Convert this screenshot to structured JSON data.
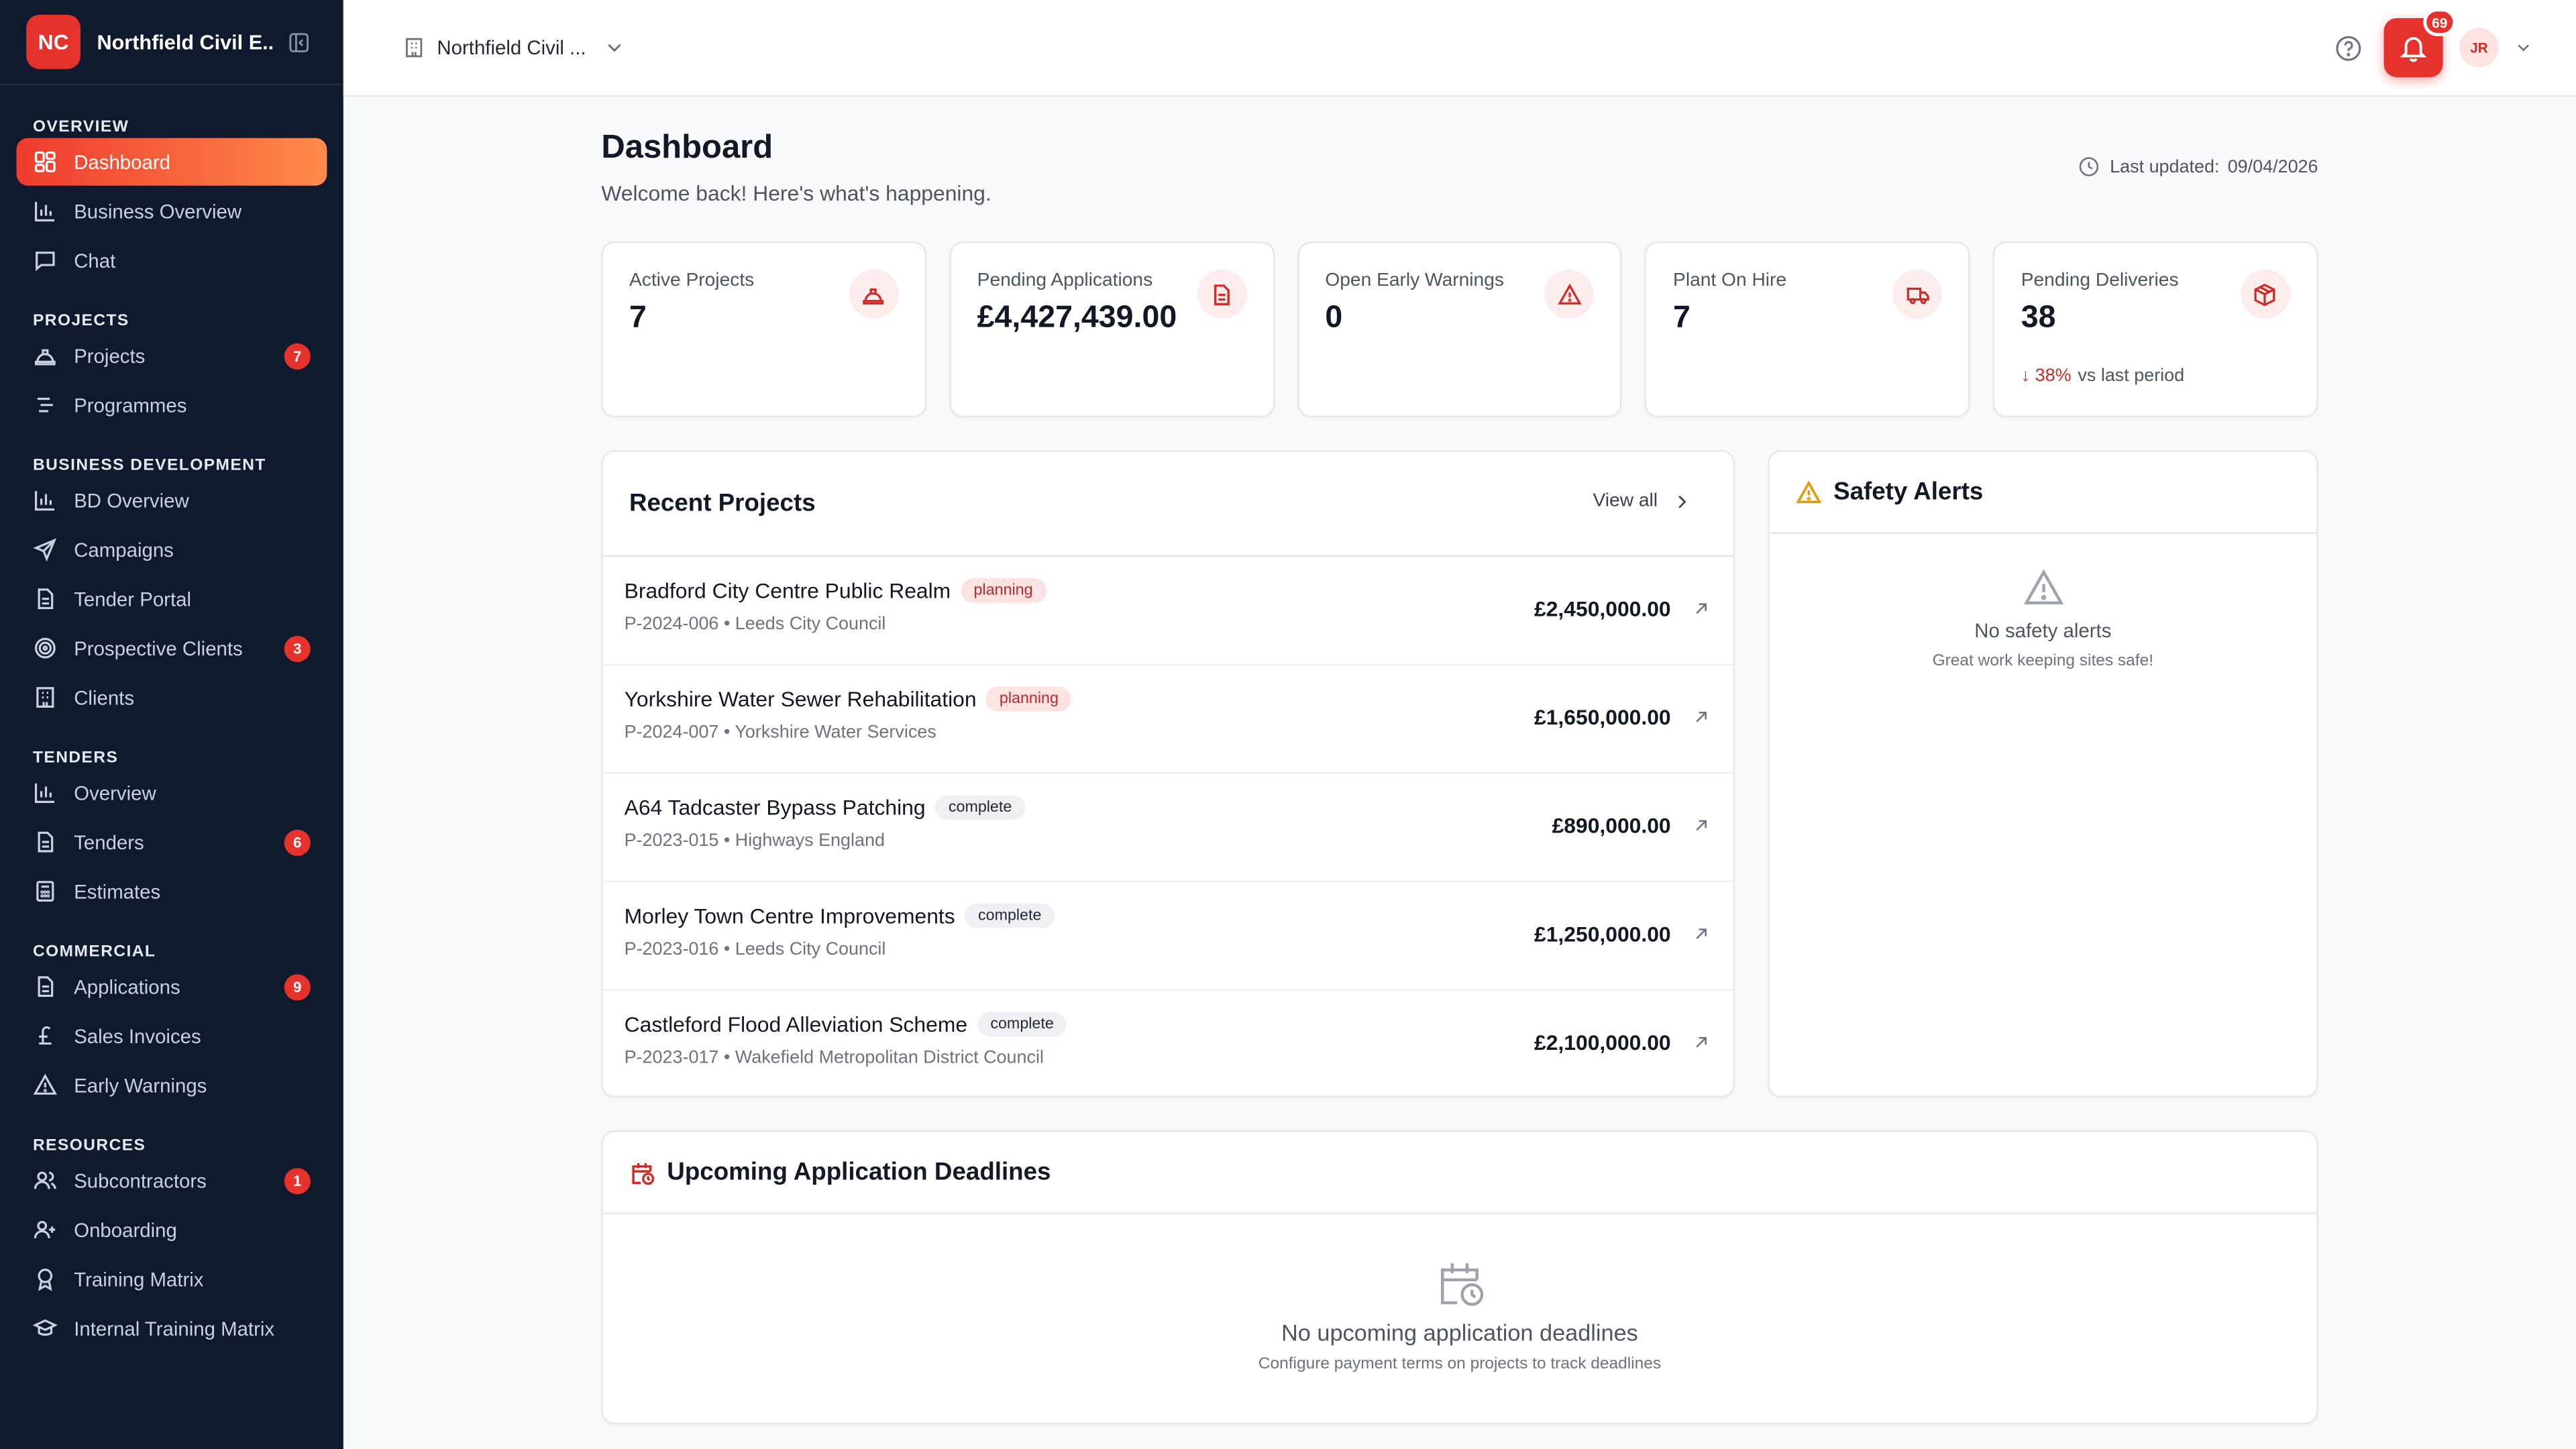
{
  "brand": {
    "initials": "NC",
    "name": "Northfield Civil E..."
  },
  "nav": {
    "sections": {
      "overview": "OVERVIEW",
      "projects": "PROJECTS",
      "business_development": "BUSINESS DEVELOPMENT",
      "tenders": "TENDERS",
      "commercial": "COMMERCIAL",
      "resources": "RESOURCES"
    },
    "items": {
      "dashboard": "Dashboard",
      "business_overview": "Business Overview",
      "chat": "Chat",
      "projects": "Projects",
      "programmes": "Programmes",
      "bd_overview": "BD Overview",
      "campaigns": "Campaigns",
      "tender_portal": "Tender Portal",
      "prospective_clients": "Prospective Clients",
      "clients": "Clients",
      "tenders_overview": "Overview",
      "tenders": "Tenders",
      "estimates": "Estimates",
      "applications": "Applications",
      "sales_invoices": "Sales Invoices",
      "early_warnings": "Early Warnings",
      "subcontractors": "Subcontractors",
      "onboarding": "Onboarding",
      "training_matrix": "Training Matrix",
      "internal_training_matrix": "Internal Training Matrix"
    },
    "badges": {
      "projects": "7",
      "prospective_clients": "3",
      "tenders": "6",
      "applications": "9",
      "subcontractors": "1"
    }
  },
  "topbar": {
    "org_name": "Northfield Civil ...",
    "notification_count": "69",
    "avatar_initials": "JR"
  },
  "page": {
    "title": "Dashboard",
    "subtitle": "Welcome back! Here's what's happening.",
    "last_updated_label": "Last updated:",
    "last_updated_value": "09/04/2026"
  },
  "stats": [
    {
      "label": "Active Projects",
      "value": "7"
    },
    {
      "label": "Pending Applications",
      "value": "£4,427,439.00"
    },
    {
      "label": "Open Early Warnings",
      "value": "0"
    },
    {
      "label": "Plant On Hire",
      "value": "7"
    },
    {
      "label": "Pending Deliveries",
      "value": "38",
      "trend": "↓ 38%",
      "trend_text": "vs last period"
    }
  ],
  "recent_projects": {
    "title": "Recent Projects",
    "view_all": "View all",
    "rows": [
      {
        "name": "Bradford City Centre Public Realm",
        "status": "planning",
        "meta": "P-2024-006 • Leeds City Council",
        "value": "£2,450,000.00"
      },
      {
        "name": "Yorkshire Water Sewer Rehabilitation",
        "status": "planning",
        "meta": "P-2024-007 • Yorkshire Water Services",
        "value": "£1,650,000.00"
      },
      {
        "name": "A64 Tadcaster Bypass Patching",
        "status": "complete",
        "meta": "P-2023-015 • Highways England",
        "value": "£890,000.00"
      },
      {
        "name": "Morley Town Centre Improvements",
        "status": "complete",
        "meta": "P-2023-016 • Leeds City Council",
        "value": "£1,250,000.00"
      },
      {
        "name": "Castleford Flood Alleviation Scheme",
        "status": "complete",
        "meta": "P-2023-017 • Wakefield Metropolitan District Council",
        "value": "£2,100,000.00"
      }
    ]
  },
  "safety_alerts": {
    "title": "Safety Alerts",
    "empty_title": "No safety alerts",
    "empty_sub": "Great work keeping sites safe!"
  },
  "deadlines": {
    "title": "Upcoming Application Deadlines",
    "empty_title": "No upcoming application deadlines",
    "empty_sub": "Configure payment terms on projects to track deadlines"
  },
  "colors": {
    "brand_red": "#e5322d",
    "sidebar_bg": "#0f1a2e",
    "active_gradient_start": "#ef3b2d",
    "active_gradient_end": "#ff8a4c",
    "planning_badge_bg": "#fde2e2",
    "complete_badge_bg": "#eef0f3",
    "safety_warning": "#e59a0b"
  }
}
